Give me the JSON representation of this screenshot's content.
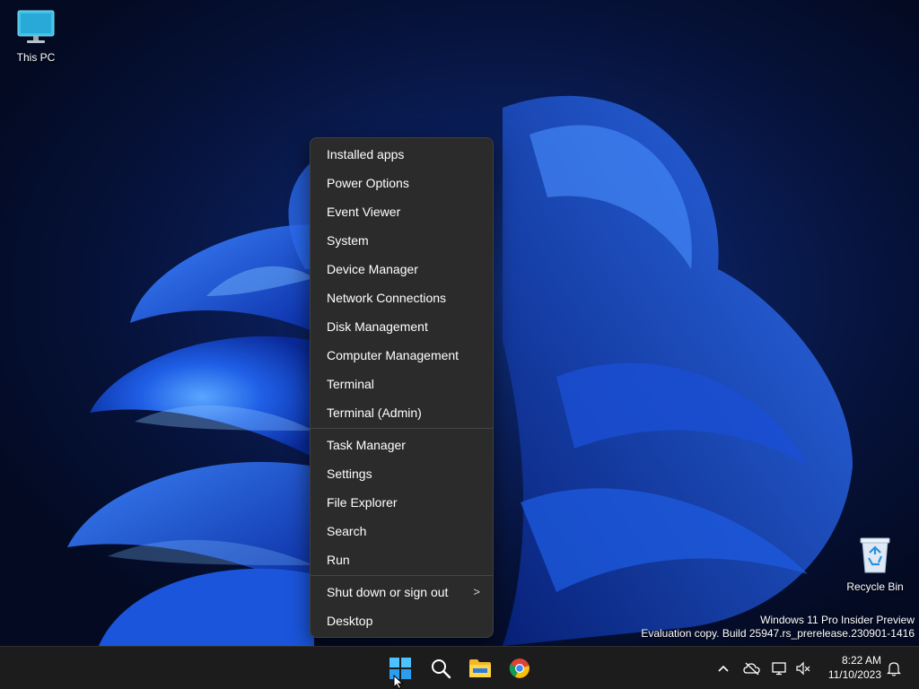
{
  "desktop": {
    "icons": [
      {
        "label": "This PC",
        "icon": "monitor-icon"
      },
      {
        "label": "Recycle Bin",
        "icon": "recycle-bin-icon"
      }
    ],
    "watermark": {
      "line1": "Windows 11 Pro Insider Preview",
      "line2": "Evaluation copy. Build 25947.rs_prerelease.230901-1416"
    }
  },
  "context_menu": {
    "group1": [
      "Installed apps",
      "Power Options",
      "Event Viewer",
      "System",
      "Device Manager",
      "Network Connections",
      "Disk Management",
      "Computer Management",
      "Terminal",
      "Terminal (Admin)"
    ],
    "group2": [
      "Task Manager",
      "Settings",
      "File Explorer",
      "Search",
      "Run"
    ],
    "group3": [
      {
        "label": "Shut down or sign out",
        "has_submenu": true,
        "arrow": ">"
      },
      {
        "label": "Desktop",
        "has_submenu": false
      }
    ]
  },
  "taskbar": {
    "pinned": [
      {
        "name": "start",
        "icon": "windows-logo-icon"
      },
      {
        "name": "search",
        "icon": "search-icon"
      },
      {
        "name": "file-explorer",
        "icon": "folder-icon"
      },
      {
        "name": "chrome",
        "icon": "chrome-icon"
      }
    ],
    "tray": {
      "icons": [
        "chevron-up-icon",
        "onedrive-offline-icon",
        "network-icon",
        "volume-muted-icon",
        "notification-bell-icon"
      ],
      "time": "8:22 AM",
      "date": "11/10/2023"
    }
  },
  "colors": {
    "menu_bg": "#2b2b2b",
    "taskbar_bg": "#1c1c1c",
    "accent_blue": "#1e73e8"
  }
}
